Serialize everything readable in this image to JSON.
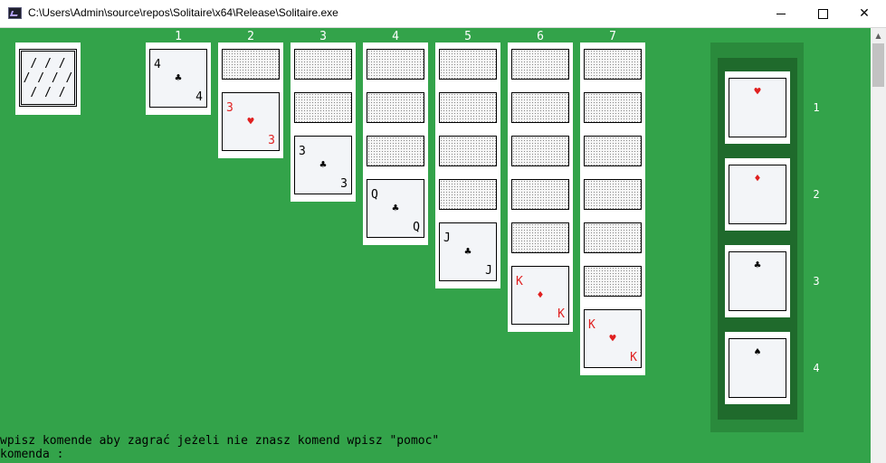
{
  "window": {
    "title": "C:\\Users\\Admin\\source\\repos\\Solitaire\\x64\\Release\\Solitaire.exe",
    "minimize_label": "—",
    "maximize_label": "☐",
    "close_label": "✕",
    "icon": "console-app-icon"
  },
  "stock": {
    "pattern": "/ / /\n/ / / /\n/ / /"
  },
  "columns": {
    "labels": [
      "1",
      "2",
      "3",
      "4",
      "5",
      "6",
      "7"
    ],
    "c1": {
      "rank": "4",
      "suit": "♣"
    },
    "c2": {
      "rank": "3",
      "suit": "♥"
    },
    "c3": {
      "rank": "3",
      "suit": "♣"
    },
    "c4": {
      "rank": "Q",
      "suit": "♣"
    },
    "c5": {
      "rank": "J",
      "suit": "♣"
    },
    "c6": {
      "rank": "K",
      "suit": "♦"
    },
    "c7": {
      "rank": "K",
      "suit": "♥"
    }
  },
  "foundations": [
    {
      "label": "1",
      "suit": "♥"
    },
    {
      "label": "2",
      "suit": "♦"
    },
    {
      "label": "3",
      "suit": "♣"
    },
    {
      "label": "4",
      "suit": "♠"
    }
  ],
  "console": {
    "hint": "wpisz komende aby zagrać jeżeli nie znasz komend wpisz \"pomoc\"",
    "prompt": "komenda :"
  },
  "colors": {
    "table": "#33a34a",
    "red_suit": "#e02020",
    "black_suit": "#000000"
  }
}
